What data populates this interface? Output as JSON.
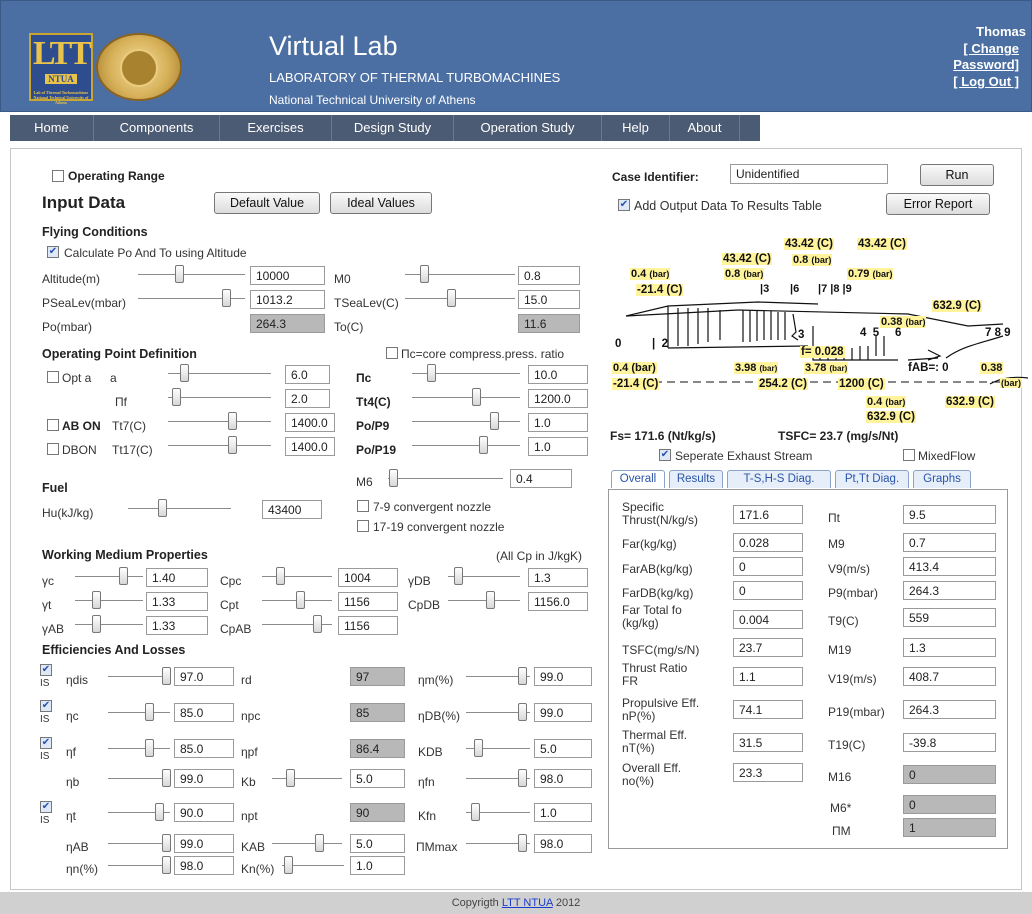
{
  "header": {
    "title": "Virtual Lab",
    "subtitle": "LABORATORY OF THERMAL TURBOMACHINES",
    "university": "National Technical University of Athens",
    "logo_text": "LTT",
    "logo_badge": "NTUA",
    "logo_small": "Lab of Thermal Turbomachines National Technical University of Athens"
  },
  "user": {
    "name": "Thomas",
    "change_pw_1": "[ Change",
    "change_pw_2": "Password]",
    "logout": "[ Log Out ]"
  },
  "nav": [
    "Home",
    "Components",
    "Exercises",
    "Design Study",
    "Operation Study",
    "Help",
    "About"
  ],
  "left": {
    "operating_range": "Operating Range",
    "input_data": "Input Data",
    "default_btn": "Default Value",
    "ideal_btn": "Ideal Values",
    "flying": {
      "title": "Flying Conditions",
      "calc": "Calculate Po And To using Altitude",
      "altitude_label": "Altitude(m)",
      "altitude": "10000",
      "m0_label": "M0",
      "m0": "0.8",
      "psea_label": "PSeaLev(mbar)",
      "psea": "1013.2",
      "tsea_label": "TSeaLev(C)",
      "tsea": "15.0",
      "po_label": "Po(mbar)",
      "po": "264.3",
      "to_label": "To(C)",
      "to": "11.6"
    },
    "op": {
      "title": "Operating Point Definition",
      "pic_label": "Πc=core compress.press. ratio",
      "opt_a": "Opt a",
      "a_label": "a",
      "a": "6.0",
      "pic": "Πc",
      "pic_val": "10.0",
      "pif_label": "Πf",
      "pif": "2.0",
      "tt4_label": "Tt4(C)",
      "tt4": "1200.0",
      "ab_on": "AB ON",
      "tt7_label": "Tt7(C)",
      "tt7": "1400.0",
      "pop9_label": "Po/P9",
      "pop9": "1.0",
      "dbon": "DBON",
      "tt17_label": "Tt17(C)",
      "tt17": "1400.0",
      "pop19_label": "Po/P19",
      "pop19": "1.0",
      "m6_label": "M6",
      "m6": "0.4",
      "conv79": "7-9 convergent nozzle",
      "conv1719": "17-19 convergent nozzle"
    },
    "fuel": {
      "title": "Fuel",
      "hu_label": "Hu(kJ/kg)",
      "hu": "43400"
    },
    "wm": {
      "title": "Working Medium Properties",
      "note": "(All Cp in J/kgK)",
      "gc_label": "γc",
      "gc": "1.40",
      "cpc_label": "Cpc",
      "cpc": "1004",
      "gdb_label": "γDB",
      "gdb": "1.3",
      "gt_label": "γt",
      "gt": "1.33",
      "cpt_label": "Cpt",
      "cpt": "1156",
      "cpdb_label": "CpDB",
      "cpdb": "1156.0",
      "gab_label": "γAB",
      "gab": "1.33",
      "cpab_label": "CpAB",
      "cpab": "1156"
    },
    "eff": {
      "title": "Efficiencies And Losses",
      "is": "IS",
      "ndis_label": "ηdis",
      "ndis": "97.0",
      "rd_label": "rd",
      "rd": "97",
      "nm_label": "ηm(%)",
      "nm": "99.0",
      "nc_label": "ηc",
      "nc": "85.0",
      "npc_label": "npc",
      "npc": "85",
      "ndb_label": "ηDB(%)",
      "ndb": "99.0",
      "nf_label": "ηf",
      "nf": "85.0",
      "npf_label": "ηpf",
      "npf": "86.4",
      "kdb_label": "KDB",
      "kdb": "5.0",
      "nb_label": "ηb",
      "nb": "99.0",
      "kb_label": "Kb",
      "kb": "5.0",
      "nfn_label": "ηfn",
      "nfn": "98.0",
      "nt_label": "ηt",
      "nt": "90.0",
      "npt_label": "npt",
      "npt": "90",
      "kfn_label": "Kfn",
      "kfn": "1.0",
      "nab_label": "ηAB",
      "nab": "99.0",
      "kab_label": "KAB",
      "kab": "5.0",
      "pimmax_label": "ΠMmax",
      "pimmax": "98.0",
      "nn_label": "ηn(%)",
      "nn": "98.0",
      "kn_label": "Kn(%)",
      "kn": "1.0"
    }
  },
  "right": {
    "case_label": "Case Identifier:",
    "case_value": "Unidentified",
    "run": "Run",
    "add_output": "Add Output Data To Results Table",
    "error_report": "Error Report",
    "diagram": {
      "fs": "Fs= 171.6 (Nt/kg/s)",
      "tsfc": "TSFC= 23.7 (mg/s/Nt)",
      "separate": "Seperate Exhaust Stream",
      "mixed": "MixedFlow"
    },
    "tabs": [
      "Overall",
      "Results",
      "T-S,H-S Diag.",
      "Pt,Tt Diag.",
      "Graphs"
    ],
    "overall": [
      {
        "l1": "Specific",
        "l2": "Thrust(N/kg/s)",
        "v": "171.6",
        "r": "Πt",
        "rv": "9.5"
      },
      {
        "l1": "Far(kg/kg)",
        "l2": "",
        "v": "0.028",
        "r": "M9",
        "rv": "0.7"
      },
      {
        "l1": "FarAB(kg/kg)",
        "l2": "",
        "v": "0",
        "r": "V9(m/s)",
        "rv": "413.4"
      },
      {
        "l1": "FarDB(kg/kg)",
        "l2": "",
        "v": "0",
        "r": "P9(mbar)",
        "rv": "264.3"
      },
      {
        "l1": "Far Total fo",
        "l2": "(kg/kg)",
        "v": "0.004",
        "r": "T9(C)",
        "rv": "559"
      },
      {
        "l1": "TSFC(mg/s/N)",
        "l2": "",
        "v": "23.7",
        "r": "M19",
        "rv": "1.3"
      },
      {
        "l1": "Thrust Ratio",
        "l2": "FR",
        "v": "1.1",
        "r": "V19(m/s)",
        "rv": "408.7"
      },
      {
        "l1": "Propulsive Eff.",
        "l2": "nP(%)",
        "v": "74.1",
        "r": "P19(mbar)",
        "rv": "264.3"
      },
      {
        "l1": "Thermal Eff.",
        "l2": "nT(%)",
        "v": "31.5",
        "r": "T19(C)",
        "rv": "-39.8"
      },
      {
        "l1": "Overall Eff.",
        "l2": "no(%)",
        "v": "23.3",
        "r": "M16",
        "rv": "0"
      },
      {
        "l1": "",
        "l2": "",
        "v": "",
        "r": "M6*",
        "rv": "0"
      },
      {
        "l1": "",
        "l2": "",
        "v": "",
        "r": "ΠM",
        "rv": "1"
      }
    ]
  },
  "footer": {
    "text": "Copyrigth",
    "link": "LTT NTUA",
    "year": "2012"
  }
}
